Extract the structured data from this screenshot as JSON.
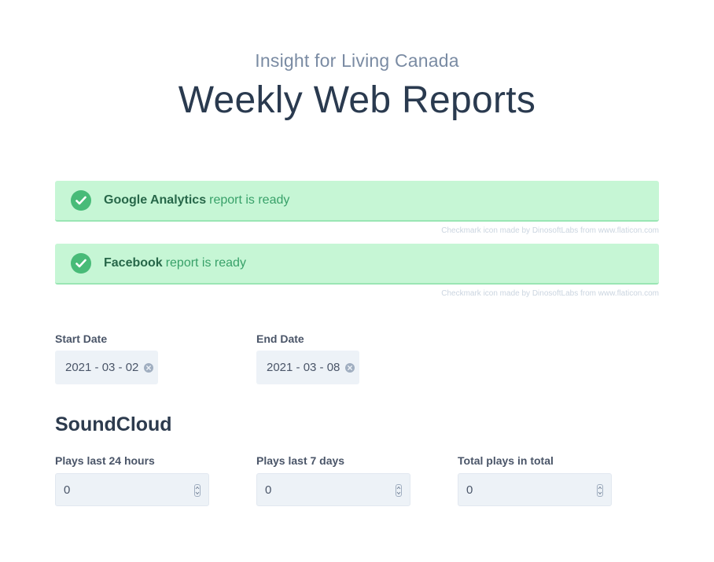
{
  "header": {
    "subtitle": "Insight for Living Canada",
    "title": "Weekly Web Reports"
  },
  "alerts": [
    {
      "source": "Google Analytics",
      "message": "report is ready",
      "credit": "Checkmark icon made by DinosoftLabs from www.flaticon.com",
      "icon": "checkmark-icon"
    },
    {
      "source": "Facebook",
      "message": "report is ready",
      "credit": "Checkmark icon made by DinosoftLabs from www.flaticon.com",
      "icon": "checkmark-icon"
    }
  ],
  "dates": {
    "start": {
      "label": "Start Date",
      "value": "2021 - 03 - 02"
    },
    "end": {
      "label": "End Date",
      "value": "2021 - 03 - 08"
    }
  },
  "soundcloud": {
    "title": "SoundCloud",
    "fields": [
      {
        "label": "Plays last 24 hours",
        "value": "0"
      },
      {
        "label": "Plays last 7 days",
        "value": "0"
      },
      {
        "label": "Total plays in total",
        "value": "0"
      }
    ]
  },
  "colors": {
    "alert_bg": "#c6f6d5",
    "check": "#48bb78",
    "input_bg": "#edf2f7"
  }
}
